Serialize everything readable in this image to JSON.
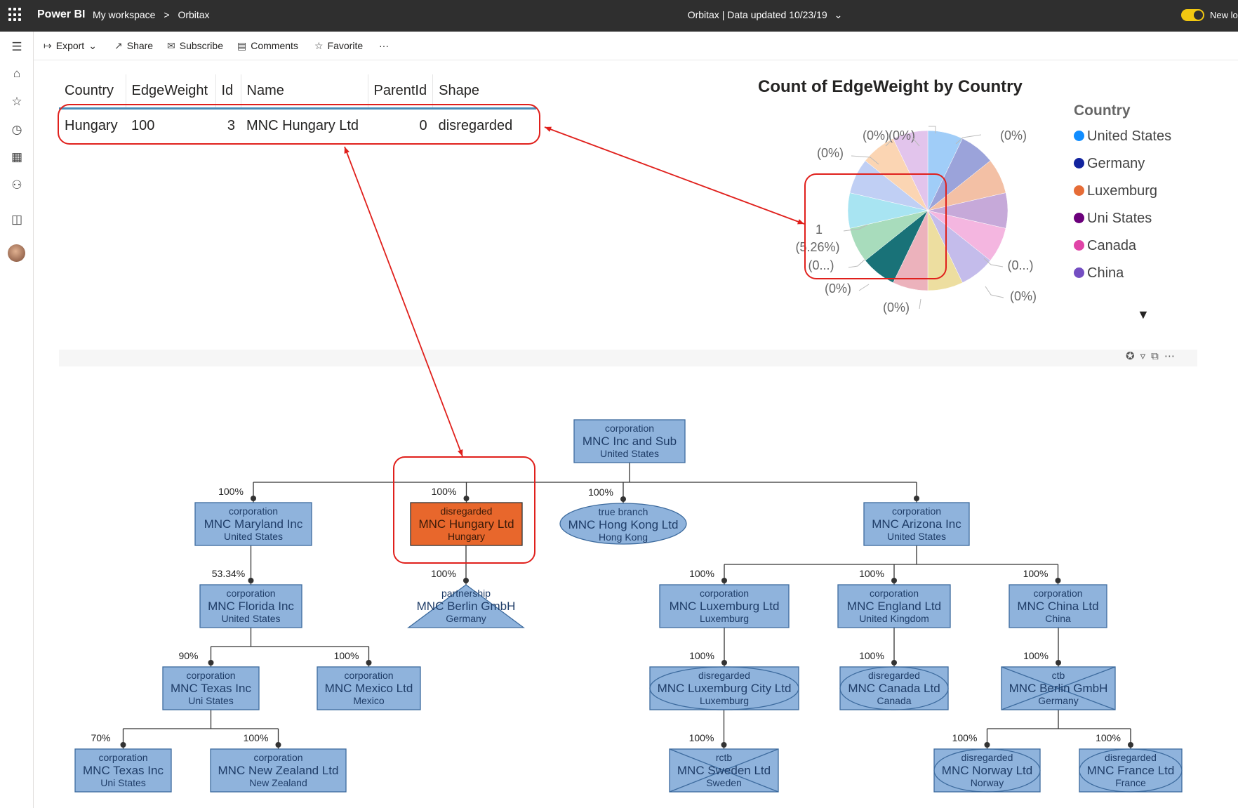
{
  "topbar": {
    "app_name": "Power BI",
    "breadcrumb": [
      "My workspace",
      "Orbitax"
    ],
    "report_title": "Orbitax",
    "data_updated": "| Data updated 10/23/19",
    "new_look_label": "New lo"
  },
  "commands": {
    "export": "Export",
    "share": "Share",
    "subscribe": "Subscribe",
    "comments": "Comments",
    "favorite": "Favorite",
    "more": "···"
  },
  "table": {
    "headers": [
      "Country",
      "EdgeWeight",
      "Id",
      "Name",
      "ParentId",
      "Shape"
    ],
    "row": [
      "Hungary",
      "100",
      "3",
      "MNC Hungary Ltd",
      "0",
      "disregarded"
    ]
  },
  "pie": {
    "title": "Count of EdgeWeight by Country",
    "legend_title": "Country",
    "legend": [
      {
        "label": "United States",
        "color": "#118dff"
      },
      {
        "label": "Germany",
        "color": "#12239e"
      },
      {
        "label": "Luxemburg",
        "color": "#e66c37"
      },
      {
        "label": "Uni States",
        "color": "#6b007b"
      },
      {
        "label": "Canada",
        "color": "#e044a7"
      },
      {
        "label": "China",
        "color": "#744ec2"
      }
    ],
    "slice_colors": [
      "#a0cdf8",
      "#9ba3da",
      "#f3c0a5",
      "#c6a9d9",
      "#f4b6e0",
      "#c4bceb",
      "#eddea0",
      "#ecb2bc",
      "#197278",
      "#a8dcbc",
      "#a8e4f2",
      "#c0cff4",
      "#fbd5b3",
      "#e2c4ec"
    ],
    "labels": [
      "(0%)",
      "(0%)",
      "(0%)",
      "(0%)",
      "(0%)",
      "(0...)",
      "(0%)",
      "(0%)",
      "1",
      "(5.26%)",
      "(0...)",
      "(0%)",
      "(0%)"
    ],
    "more_icon": "triangle-down-icon"
  },
  "chart_data": {
    "type": "pie",
    "title": "Count of EdgeWeight by Country",
    "legend_title": "Country",
    "categories": [
      "United States",
      "Germany",
      "Luxemburg",
      "Uni States",
      "Canada",
      "China",
      "Hong Kong",
      "Mexico",
      "Hungary",
      "United Kingdom",
      "Norway",
      "France",
      "Sweden",
      "New Zealand"
    ],
    "values": [
      1,
      1,
      1,
      1,
      1,
      1,
      1,
      1,
      1,
      1,
      1,
      1,
      1,
      1
    ],
    "visible_labels": [
      "1 (5.26%)",
      "(0%)",
      "(0...)"
    ]
  },
  "org": {
    "nodes": [
      {
        "id": "root",
        "type": "corporation",
        "name": "MNC Inc and Sub",
        "country": "United States"
      },
      {
        "id": "maryland",
        "type": "corporation",
        "name": "MNC Maryland Inc",
        "country": "United States",
        "pct": "100%"
      },
      {
        "id": "hungary",
        "type": "disregarded",
        "name": "MNC Hungary Ltd",
        "country": "Hungary",
        "pct": "100%"
      },
      {
        "id": "hongkong",
        "type": "true branch",
        "name": "MNC Hong Kong Ltd",
        "country": "Hong Kong",
        "pct": "100%"
      },
      {
        "id": "arizona",
        "type": "corporation",
        "name": "MNC Arizona Inc",
        "country": "United States"
      },
      {
        "id": "florida",
        "type": "corporation",
        "name": "MNC Florida Inc",
        "country": "United States",
        "pct": "53.34%"
      },
      {
        "id": "berlin1",
        "type": "partnership",
        "name": "MNC Berlin GmbH",
        "country": "Germany",
        "pct": "100%"
      },
      {
        "id": "luxltd",
        "type": "corporation",
        "name": "MNC Luxemburg Ltd",
        "country": "Luxemburg",
        "pct": "100%"
      },
      {
        "id": "england",
        "type": "corporation",
        "name": "MNC England Ltd",
        "country": "United Kingdom",
        "pct": "100%"
      },
      {
        "id": "china",
        "type": "corporation",
        "name": "MNC China Ltd",
        "country": "China",
        "pct": "100%"
      },
      {
        "id": "texas1",
        "type": "corporation",
        "name": "MNC Texas Inc",
        "country": "Uni States",
        "pct": "90%"
      },
      {
        "id": "mexico",
        "type": "corporation",
        "name": "MNC Mexico Ltd",
        "country": "Mexico",
        "pct": "100%"
      },
      {
        "id": "luxcity",
        "type": "disregarded",
        "name": "MNC Luxemburg City Ltd",
        "country": "Luxemburg",
        "pct": "100%"
      },
      {
        "id": "canada",
        "type": "disregarded",
        "name": "MNC Canada Ltd",
        "country": "Canada",
        "pct": "100%"
      },
      {
        "id": "berlin2",
        "type": "ctb",
        "name": "MNC Berlin GmbH",
        "country": "Germany",
        "pct": "100%"
      },
      {
        "id": "texas2",
        "type": "corporation",
        "name": "MNC Texas Inc",
        "country": "Uni States",
        "pct": "70%"
      },
      {
        "id": "nz",
        "type": "corporation",
        "name": "MNC New Zealand Ltd",
        "country": "New Zealand",
        "pct": "100%"
      },
      {
        "id": "sweden",
        "type": "rctb",
        "name": "MNC Sweden Ltd",
        "country": "Sweden",
        "pct": "100%"
      },
      {
        "id": "norway",
        "type": "disregarded",
        "name": "MNC Norway Ltd",
        "country": "Norway",
        "pct": "100%"
      },
      {
        "id": "france",
        "type": "disregarded",
        "name": "MNC France Ltd",
        "country": "France",
        "pct": "100%"
      }
    ]
  },
  "colors": {
    "node_fill": "#8fb3dc",
    "node_stroke": "#3d6b9e",
    "node_text": "#1f3d68",
    "selected_fill": "#e8672c",
    "highlight": "#e0201c",
    "topbar": "#2f2f2f"
  }
}
